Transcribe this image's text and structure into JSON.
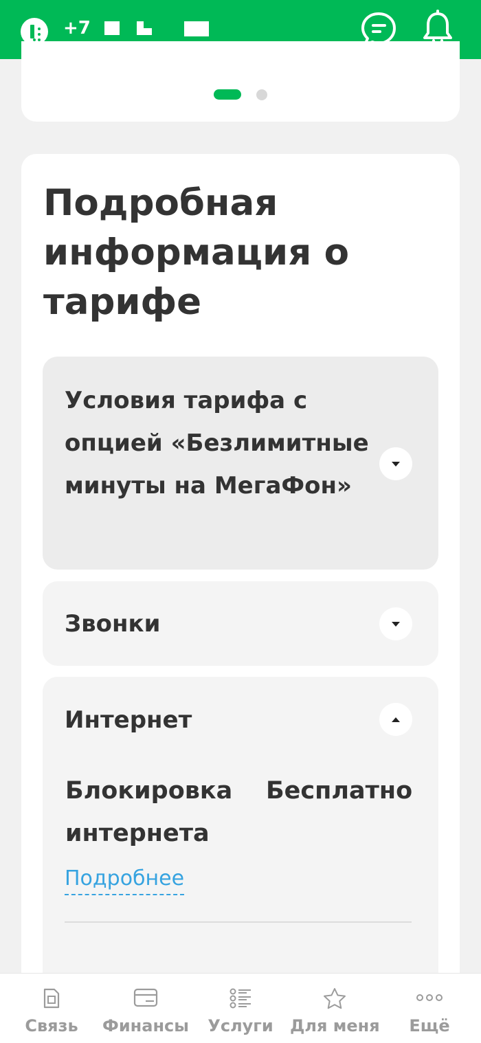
{
  "header": {
    "phone_prefix": "+7",
    "chat_icon": "chat-bubble-icon",
    "notifications_icon": "bell-icon",
    "logo_icon": "megafon-logo-icon"
  },
  "carousel": {
    "active_index": 0,
    "count": 2
  },
  "tariff": {
    "title": "Подробная информация о тарифе",
    "sections": [
      {
        "title": "Условия тарифа с опцией «Безлимитные минуты на МегаФон»",
        "expanded": false
      },
      {
        "title": "Звонки",
        "expanded": false
      },
      {
        "title": "Интернет",
        "expanded": true,
        "rows": [
          {
            "label": "Блокировка интернета",
            "value": "Бесплатно",
            "link": "Подробнее"
          }
        ]
      }
    ]
  },
  "bottom_nav": {
    "items": [
      {
        "label": "Связь",
        "icon": "sim-card-icon"
      },
      {
        "label": "Финансы",
        "icon": "wallet-icon"
      },
      {
        "label": "Услуги",
        "icon": "services-list-icon"
      },
      {
        "label": "Для меня",
        "icon": "star-icon"
      },
      {
        "label": "Ещё",
        "icon": "more-dots-icon"
      }
    ]
  },
  "colors": {
    "brand_green": "#00b956",
    "link_blue": "#36a3e0",
    "text": "#333333",
    "nav_text": "#9b9b9b"
  }
}
